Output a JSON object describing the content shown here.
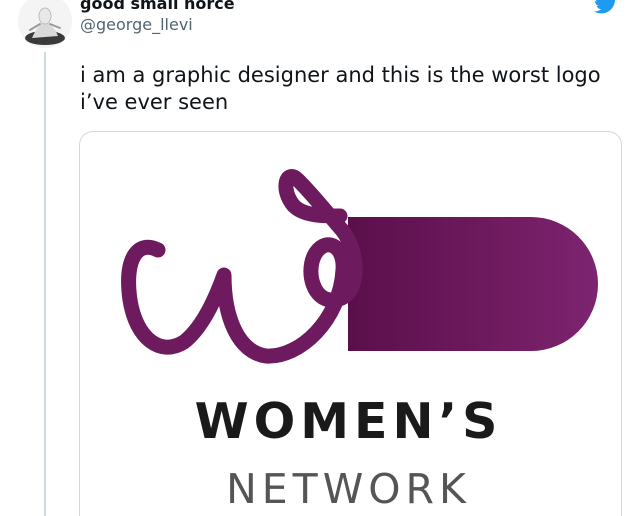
{
  "tweet": {
    "author": {
      "display_name": "good small horce",
      "handle": "@george_llevi",
      "avatar": "user-avatar-photo"
    },
    "platform_icon": "twitter-bird-icon",
    "text": "i am a graphic designer and this is the worst logo i’ve ever seen",
    "media": {
      "logo_icon": "script-w-logo-mark",
      "brand_line1": "WOMEN’S",
      "brand_line2": "NETWORK"
    }
  },
  "colors": {
    "brand_purple": "#6e1a5e",
    "twitter_blue": "#1d9bf0",
    "handle_gray": "#536471",
    "thread_line": "#cfd9de"
  }
}
